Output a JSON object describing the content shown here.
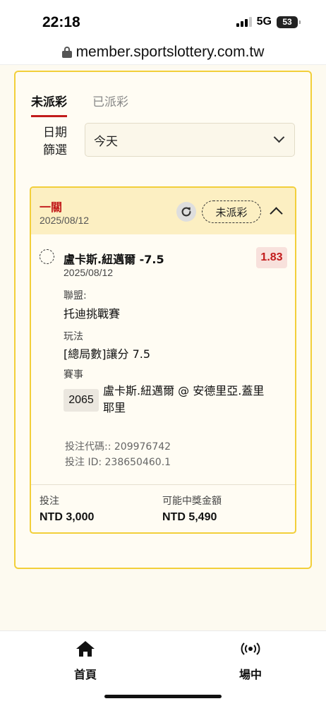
{
  "status_bar": {
    "time": "22:18",
    "network": "5G",
    "battery": "53"
  },
  "browser": {
    "url": "member.sportslottery.com.tw"
  },
  "tabs": [
    {
      "label": "未派彩",
      "active": true
    },
    {
      "label": "已派彩",
      "active": false
    }
  ],
  "date_filter": {
    "label": "日期篩選",
    "selected": "今天"
  },
  "bet": {
    "type": "一關",
    "date": "2025/08/12",
    "status": "未派彩",
    "selection": "盧卡斯.紐邁爾 -7.5",
    "selection_date": "2025/08/12",
    "odds": "1.83",
    "league_label": "聯盟:",
    "league": "托迪挑戰賽",
    "market_label": "玩法",
    "market": "[總局數]讓分 7.5",
    "event_label": "賽事",
    "event_code": "2065",
    "event_name": "盧卡斯.紐邁爾 @ 安德里亞.蓋里耶里",
    "bet_code": "投注代碼:: 209976742",
    "bet_id": "投注 ID: 238650460.1",
    "stake_label": "投注",
    "stake": "NTD 3,000",
    "payout_label": "可能中獎金額",
    "payout": "NTD 5,490"
  },
  "nav": [
    {
      "label": "首頁",
      "icon": "home-icon"
    },
    {
      "label": "場中",
      "icon": "live-broadcast-icon"
    }
  ],
  "colors": {
    "accent_red": "#c21b1b",
    "accent_yellow": "#f2cf3a",
    "header_bg": "#fcefc2"
  }
}
